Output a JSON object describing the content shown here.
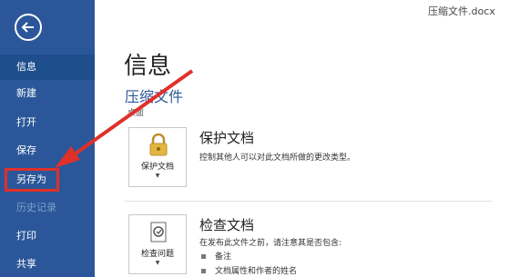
{
  "window": {
    "title": "压缩文件.docx"
  },
  "sidebar": {
    "back_icon": "back-arrow-icon",
    "items": [
      {
        "label": "信息"
      },
      {
        "label": "新建"
      },
      {
        "label": "打开"
      },
      {
        "label": "保存"
      },
      {
        "label": "另存为"
      },
      {
        "label": "历史记录"
      },
      {
        "label": "打印"
      },
      {
        "label": "共享"
      }
    ]
  },
  "main": {
    "heading": "信息",
    "file_name": "压缩文件",
    "location": "桌面",
    "protect": {
      "button_label": "保护文档",
      "button_arrow": "▼",
      "icon": "lock-key-icon",
      "title": "保护文档",
      "description": "控制其他人可以对此文档所做的更改类型。"
    },
    "inspect": {
      "button_label": "检查问题",
      "button_arrow": "▼",
      "icon": "inspect-document-icon",
      "title": "检查文档",
      "description": "在发布此文件之前，请注意其是否包含:",
      "bullets": [
        "备注",
        "文档属性和作者的姓名"
      ]
    }
  },
  "colors": {
    "sidebar": "#2b579a",
    "highlight": "#e0302a",
    "accent": "#2b579a"
  }
}
